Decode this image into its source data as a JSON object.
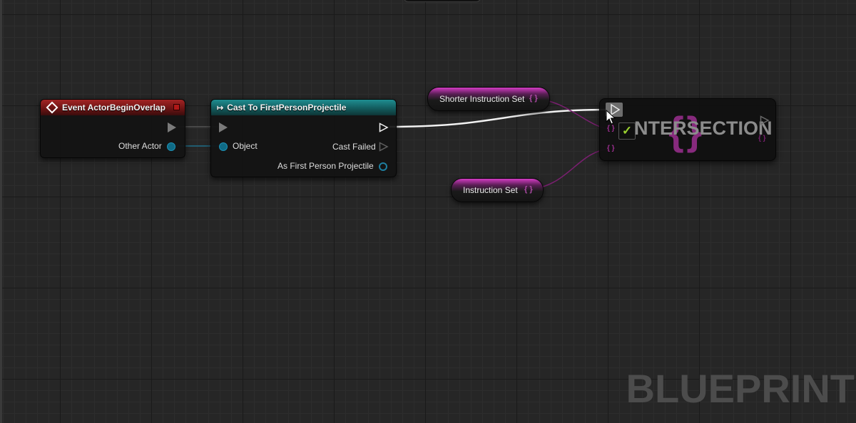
{
  "event_node": {
    "title": "Event ActorBeginOverlap",
    "pins": {
      "other_actor": "Other Actor"
    },
    "color": "#a32424"
  },
  "cast_node": {
    "title": "Cast To FirstPersonProjectile",
    "pins": {
      "object": "Object",
      "cast_failed": "Cast Failed",
      "as_first_person_projectile": "As First Person Projectile"
    },
    "color": "#1f8d90"
  },
  "variables": {
    "shorter_instruction_set": "Shorter Instruction Set",
    "instruction_set": "Instruction Set",
    "set_pin_glyph": "{ }",
    "color": "#d43cc4"
  },
  "intersection_node": {
    "title": "NTERSECTION",
    "checkbox_mark": "✓",
    "checkbox_checked": true,
    "brace_glyph": "{ }"
  },
  "watermark": "BLUEPRINT",
  "icons": {
    "event": "diamond-icon",
    "cast": "cast-arrow-icon",
    "cursor": "mouse-pointer-icon"
  }
}
